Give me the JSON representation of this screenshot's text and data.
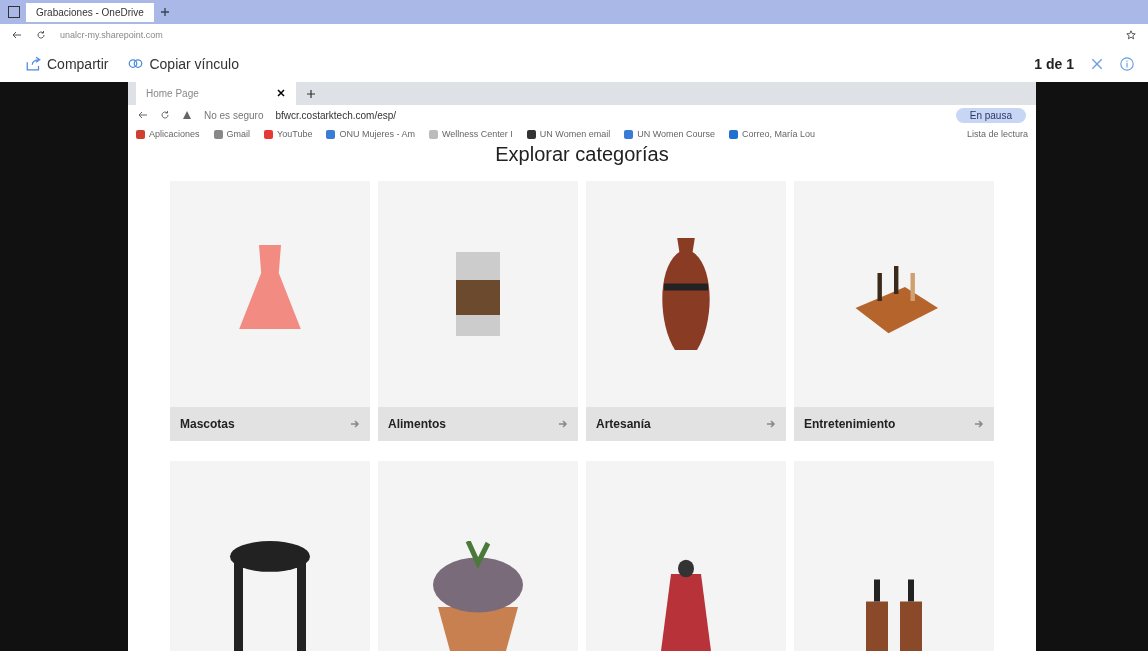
{
  "browser": {
    "tab_title": "Grabaciones - OneDrive",
    "address": "unalcr-my.sharepoint.com"
  },
  "viewer_toolbar": {
    "share": "Compartir",
    "copy_link": "Copiar vínculo",
    "page_count": "1 de 1"
  },
  "inner_browser": {
    "tab_title": "Home Page",
    "security": "No es seguro",
    "address": "bfwcr.costarktech.com/esp/",
    "profile": "En pausa",
    "bookmarks": [
      {
        "label": "Aplicaciones",
        "color": "#d04030"
      },
      {
        "label": "Gmail",
        "color": "#888888"
      },
      {
        "label": "YouTube",
        "color": "#e53935"
      },
      {
        "label": "ONU Mujeres - Am",
        "color": "#3a7bd5"
      },
      {
        "label": "Wellness Center I",
        "color": "#bbbbbb"
      },
      {
        "label": "UN Women email",
        "color": "#333333"
      },
      {
        "label": "UN Women Course",
        "color": "#3a7bd5"
      },
      {
        "label": "Correo, María Lou",
        "color": "#1e6fd0"
      }
    ],
    "reading_list": "Lista de lectura"
  },
  "page": {
    "heading": "Explorar categorías",
    "categories": [
      {
        "label": "Mascotas",
        "kind": "dress"
      },
      {
        "label": "Alimentos",
        "kind": "can"
      },
      {
        "label": "Artesanía",
        "kind": "vase"
      },
      {
        "label": "Entretenimiento",
        "kind": "chess"
      },
      {
        "kind": "stool"
      },
      {
        "kind": "plant"
      },
      {
        "kind": "shawl"
      },
      {
        "kind": "bottles"
      }
    ]
  }
}
